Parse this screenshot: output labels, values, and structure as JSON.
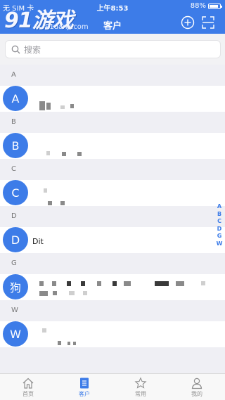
{
  "status_bar": {
    "carrier": "无 SIM 卡",
    "time": "上午8:53",
    "battery": "88%",
    "battery_level": 0.88
  },
  "watermark": {
    "logo": "91游戏",
    "site": "91danji.com"
  },
  "header": {
    "title": "客户"
  },
  "search": {
    "placeholder": "搜索"
  },
  "sections": [
    {
      "letter": "A",
      "avatar": "A",
      "text": ""
    },
    {
      "letter": "B",
      "avatar": "B",
      "text": ""
    },
    {
      "letter": "C",
      "avatar": "C",
      "text": ""
    },
    {
      "letter": "D",
      "avatar": "D",
      "text": "Dit"
    },
    {
      "letter": "G",
      "avatar": "狗",
      "text": ""
    },
    {
      "letter": "W",
      "avatar": "W",
      "text": ""
    }
  ],
  "index_letters": [
    "A",
    "B",
    "C",
    "D",
    "G",
    "W"
  ],
  "tabs": [
    {
      "label": "首页",
      "icon": "home-icon",
      "active": false
    },
    {
      "label": "客户",
      "icon": "customer-list-icon",
      "active": true
    },
    {
      "label": "常用",
      "icon": "star-icon",
      "active": false
    },
    {
      "label": "我的",
      "icon": "profile-icon",
      "active": false
    }
  ],
  "colors": {
    "accent": "#3d7ce8",
    "section_bg": "#efeff4",
    "tab_inactive": "#8f8f8f"
  }
}
